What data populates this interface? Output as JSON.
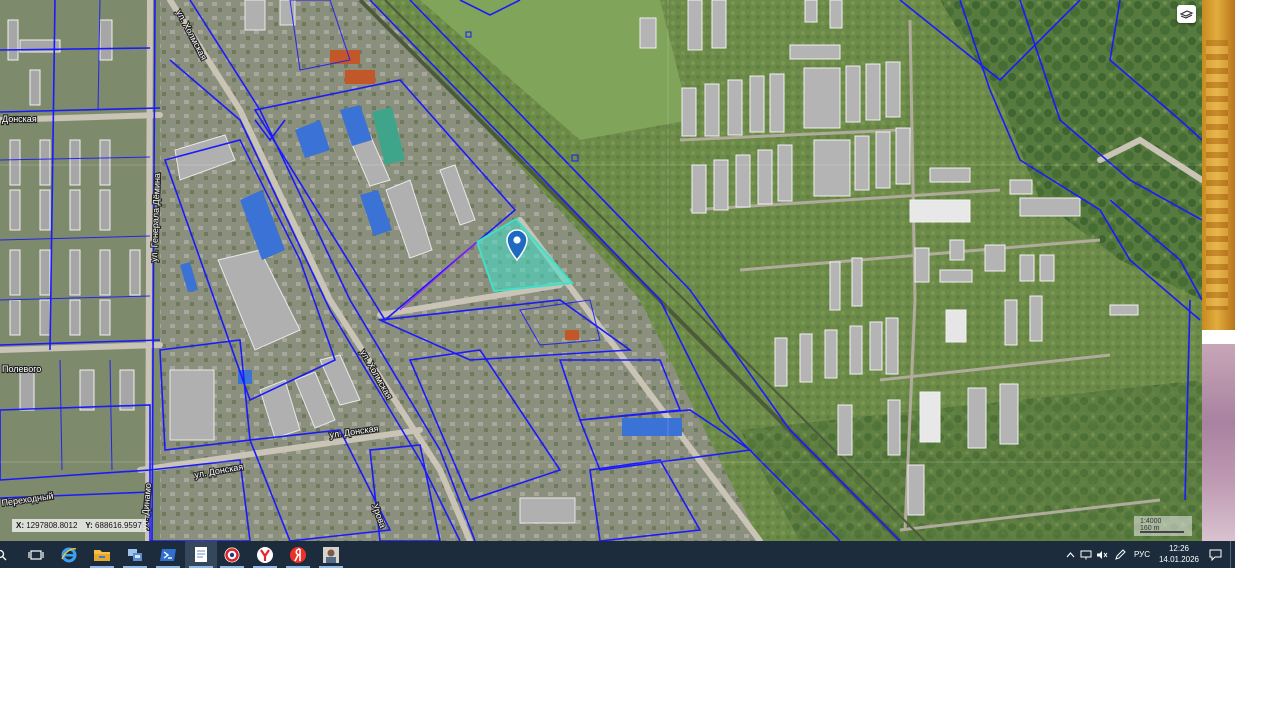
{
  "map": {
    "coordinates": {
      "x_label": "X:",
      "x_value": "1297808.8012",
      "y_label": "Y:",
      "y_value": "688616.9597"
    },
    "scale": {
      "ratio": "1:4000",
      "distance": "160 m"
    },
    "street_labels": [
      "ул. Холмская",
      "ул. Донская",
      "ул. Донская",
      "Донская",
      "ул. Холмская",
      "ул. Генерала Дёмина",
      "ул. Динамо",
      "Переходный",
      "Полевого",
      "Урова"
    ],
    "selected_parcel_color": "#40e0c8",
    "boundary_color": "#1a1aff"
  },
  "taskbar": {
    "apps": [
      {
        "name": "search-icon",
        "active": false
      },
      {
        "name": "task-view-icon",
        "active": false
      },
      {
        "name": "internet-explorer-icon",
        "active": false
      },
      {
        "name": "file-explorer-icon",
        "active": false
      },
      {
        "name": "network-app-icon",
        "active": false
      },
      {
        "name": "powershell-icon",
        "active": false
      },
      {
        "name": "notepad-icon",
        "active": true
      },
      {
        "name": "chrome-like-icon",
        "active": false
      },
      {
        "name": "yandex-browser-icon",
        "active": false
      },
      {
        "name": "yandex-icon",
        "active": false
      },
      {
        "name": "photo-app-icon",
        "active": false
      }
    ],
    "tray": {
      "language": "РУС",
      "time": "12:26",
      "date": "14.01.2026"
    }
  }
}
